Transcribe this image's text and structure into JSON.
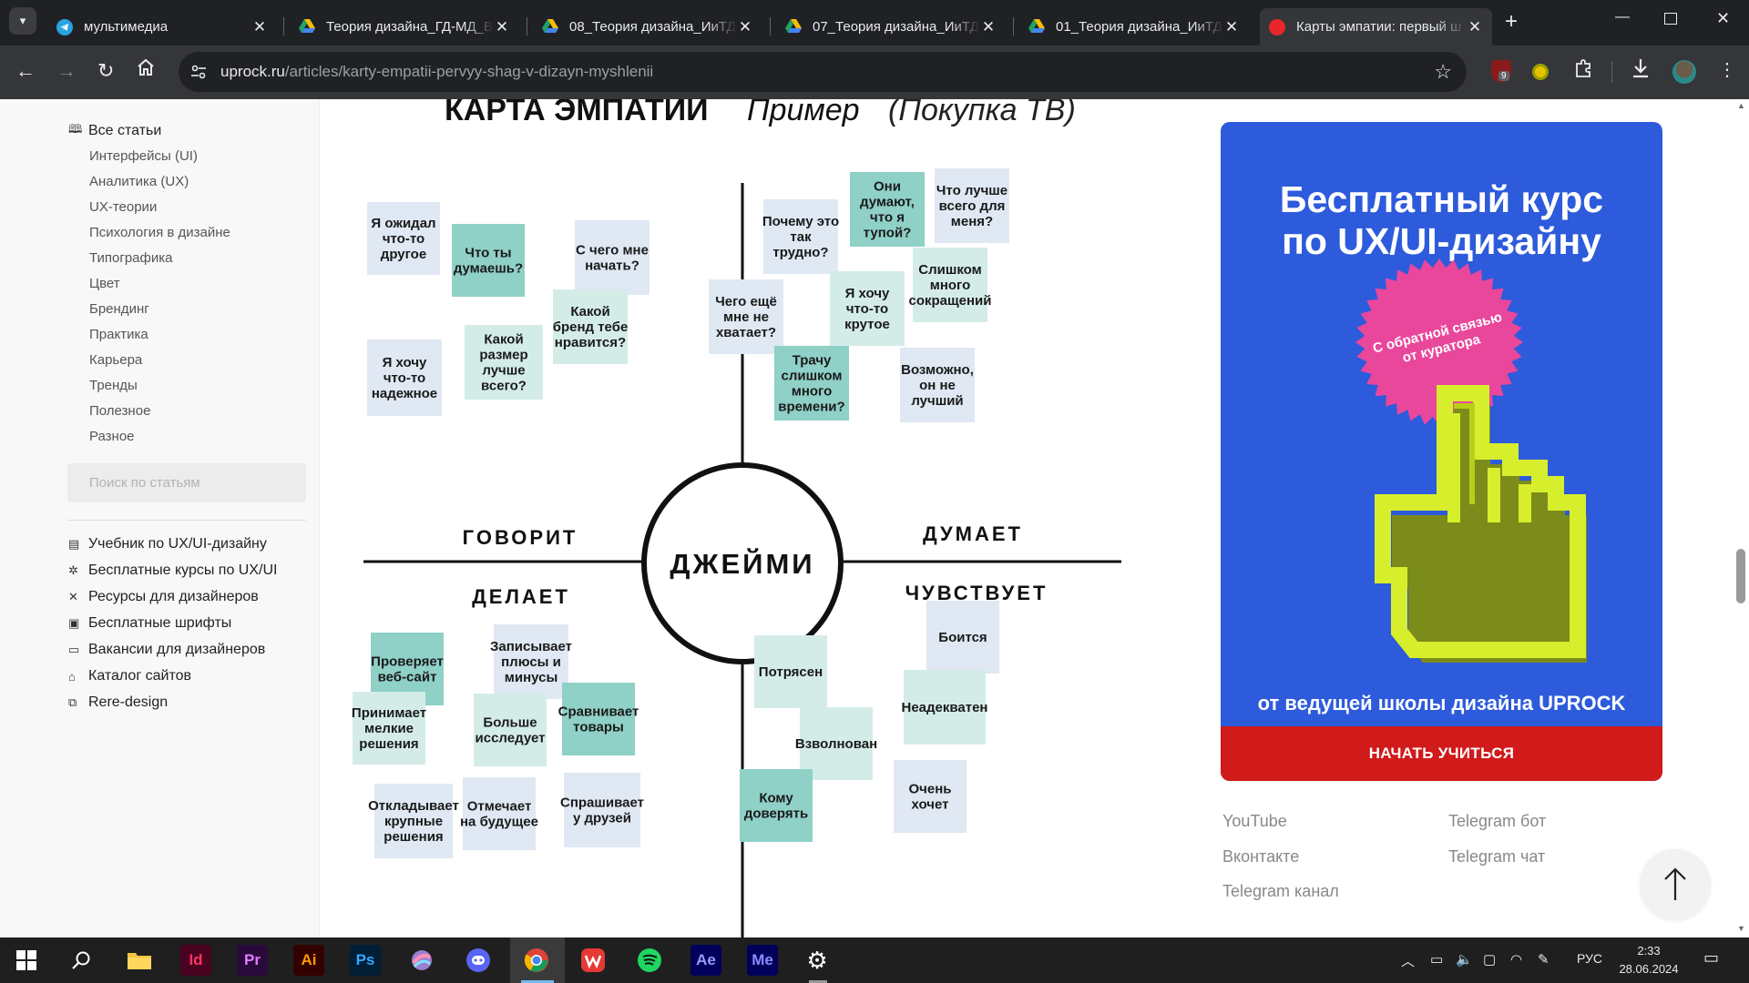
{
  "browser": {
    "tabs": [
      {
        "title": "мультимедиа",
        "favicon": "telegram-icon"
      },
      {
        "title": "Теория дизайна_ГД-МД_В",
        "favicon": "google-drive-icon"
      },
      {
        "title": "08_Теория дизайна_ИиТД",
        "favicon": "google-drive-icon"
      },
      {
        "title": "07_Теория дизайна_ИиТД",
        "favicon": "google-drive-icon"
      },
      {
        "title": "01_Теория дизайна_ИиТД",
        "favicon": "google-drive-icon"
      },
      {
        "title": "Карты эмпатии: первый ш",
        "favicon": "uprock-icon",
        "active": true
      }
    ],
    "url_domain": "uprock.ru",
    "url_path": "/articles/karty-empatii-pervyy-shag-v-dizayn-myshlenii",
    "ext_badge": "9"
  },
  "sidebar": {
    "all_articles": "Все статьи",
    "categories": [
      "Интерфейсы (UI)",
      "Аналитика (UX)",
      "UX-теории",
      "Психология в дизайне",
      "Типографика",
      "Цвет",
      "Брендинг",
      "Практика",
      "Карьера",
      "Тренды",
      "Полезное",
      "Разное"
    ],
    "search_placeholder": "Поиск по статьям",
    "links": [
      {
        "label": "Учебник по UX/UI-дизайну",
        "icon": "book-icon"
      },
      {
        "label": "Бесплатные курсы по UX/UI",
        "icon": "sparkle-icon"
      },
      {
        "label": "Ресурсы для дизайнеров",
        "icon": "tools-icon"
      },
      {
        "label": "Бесплатные шрифты",
        "icon": "font-icon"
      },
      {
        "label": "Вакансии для дизайнеров",
        "icon": "briefcase-icon"
      },
      {
        "label": "Каталог сайтов",
        "icon": "catalog-icon"
      },
      {
        "label": "Rere-design",
        "icon": "copy-icon"
      }
    ]
  },
  "map": {
    "title": "КАРТА ЭМПАТИИ",
    "title_italic": "Пример",
    "title_paren": "(Покупка ТВ)",
    "center": "ДЖЕЙМИ",
    "q_says": "ГОВОРИТ",
    "q_thinks": "ДУМАЕТ",
    "q_does": "ДЕЛАЕТ",
    "q_feels": "ЧУВСТВУЕТ",
    "notes_says": [
      {
        "text": "Я ожидал что-то другое",
        "color": "#dfe8f3"
      },
      {
        "text": "Что ты думаешь?",
        "color": "#8fd0c7"
      },
      {
        "text": "С чего мне начать?",
        "color": "#dfe8f3"
      },
      {
        "text": "Какой бренд тебе нравится?",
        "color": "#d4ece8"
      },
      {
        "text": "Я хочу что-то надежное",
        "color": "#dfe8f3"
      },
      {
        "text": "Какой размер лучше всего?",
        "color": "#d4ece8"
      }
    ],
    "notes_thinks": [
      {
        "text": "Почему это так трудно?",
        "color": "#dfe8f3"
      },
      {
        "text": "Они думают, что я тупой?",
        "color": "#8fd0c7"
      },
      {
        "text": "Что лучше всего для меня?",
        "color": "#dfe8f3"
      },
      {
        "text": "Слишком много сокращений",
        "color": "#d4ece8"
      },
      {
        "text": "Чего ещё мне не хватает?",
        "color": "#dfe8f3"
      },
      {
        "text": "Я хочу что-то крутое",
        "color": "#d4ece8"
      },
      {
        "text": "Трачу слишком много времени?",
        "color": "#8fd0c7"
      },
      {
        "text": "Возможно, он не лучший",
        "color": "#dfe8f3"
      }
    ],
    "notes_does": [
      {
        "text": "Проверяет веб-сайт",
        "color": "#8fd0c7"
      },
      {
        "text": "Записывает плюсы и минусы",
        "color": "#dfe8f3"
      },
      {
        "text": "Принимает мелкие решения",
        "color": "#d4ece8"
      },
      {
        "text": "Больше исследует",
        "color": "#d4ece8"
      },
      {
        "text": "Сравнивает товары",
        "color": "#8fd0c7"
      },
      {
        "text": "Откладывает крупные решения",
        "color": "#dfe8f3"
      },
      {
        "text": "Отмечает на будущее",
        "color": "#dfe8f3"
      },
      {
        "text": "Спрашивает у друзей",
        "color": "#dfe8f3"
      }
    ],
    "notes_feels": [
      {
        "text": "Потрясен",
        "color": "#d4ece8"
      },
      {
        "text": "Боится",
        "color": "#dfe8f3"
      },
      {
        "text": "Неадекватен",
        "color": "#d4ece8"
      },
      {
        "text": "Взволнован",
        "color": "#d4ece8"
      },
      {
        "text": "Очень хочет",
        "color": "#dfe8f3"
      },
      {
        "text": "Кому доверять",
        "color": "#8fd0c7"
      }
    ]
  },
  "promo": {
    "title_line1": "Бесплатный курс",
    "title_line2": "по UX/UI-дизайну",
    "badge_line1": "С обратной связью",
    "badge_line2": "от куратора",
    "subtitle": "от ведущей школы дизайна UPROCK",
    "button": "НАЧАТЬ УЧИТЬСЯ",
    "accent": "#2d5bdb",
    "button_color": "#d11a1a"
  },
  "social": {
    "youtube": "YouTube",
    "vk": "Вконтакте",
    "tg_channel": "Telegram канал",
    "tg_bot": "Telegram бот",
    "tg_chat": "Telegram чат"
  },
  "taskbar": {
    "apps": [
      "Id",
      "Pr",
      "Ai",
      "Ps",
      "Ae",
      "Me"
    ],
    "lang": "РУС",
    "time": "2:33",
    "date": "28.06.2024"
  }
}
